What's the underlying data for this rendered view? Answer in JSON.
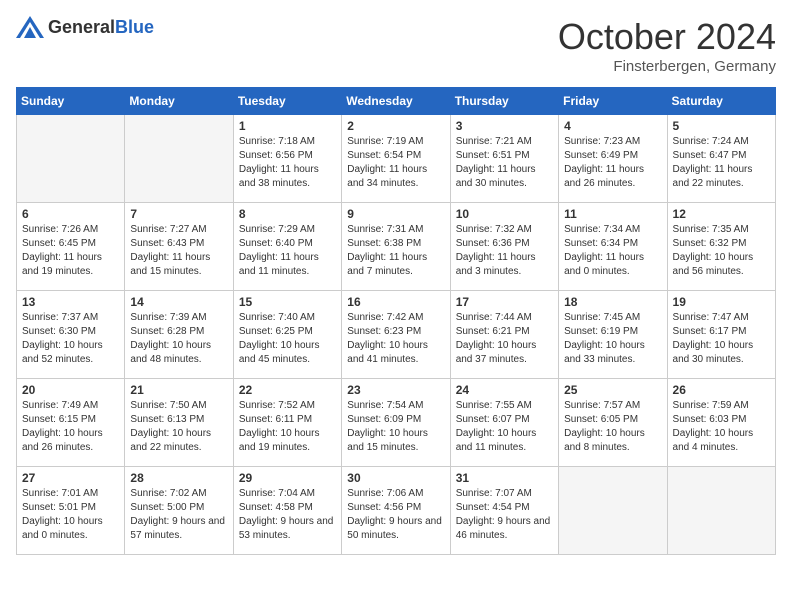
{
  "header": {
    "logo_general": "General",
    "logo_blue": "Blue",
    "month_year": "October 2024",
    "location": "Finsterbergen, Germany"
  },
  "days_of_week": [
    "Sunday",
    "Monday",
    "Tuesday",
    "Wednesday",
    "Thursday",
    "Friday",
    "Saturday"
  ],
  "weeks": [
    [
      {
        "day": "",
        "sunrise": "",
        "sunset": "",
        "daylight": "",
        "empty": true
      },
      {
        "day": "",
        "sunrise": "",
        "sunset": "",
        "daylight": "",
        "empty": true
      },
      {
        "day": "1",
        "sunrise": "Sunrise: 7:18 AM",
        "sunset": "Sunset: 6:56 PM",
        "daylight": "Daylight: 11 hours and 38 minutes."
      },
      {
        "day": "2",
        "sunrise": "Sunrise: 7:19 AM",
        "sunset": "Sunset: 6:54 PM",
        "daylight": "Daylight: 11 hours and 34 minutes."
      },
      {
        "day": "3",
        "sunrise": "Sunrise: 7:21 AM",
        "sunset": "Sunset: 6:51 PM",
        "daylight": "Daylight: 11 hours and 30 minutes."
      },
      {
        "day": "4",
        "sunrise": "Sunrise: 7:23 AM",
        "sunset": "Sunset: 6:49 PM",
        "daylight": "Daylight: 11 hours and 26 minutes."
      },
      {
        "day": "5",
        "sunrise": "Sunrise: 7:24 AM",
        "sunset": "Sunset: 6:47 PM",
        "daylight": "Daylight: 11 hours and 22 minutes."
      }
    ],
    [
      {
        "day": "6",
        "sunrise": "Sunrise: 7:26 AM",
        "sunset": "Sunset: 6:45 PM",
        "daylight": "Daylight: 11 hours and 19 minutes."
      },
      {
        "day": "7",
        "sunrise": "Sunrise: 7:27 AM",
        "sunset": "Sunset: 6:43 PM",
        "daylight": "Daylight: 11 hours and 15 minutes."
      },
      {
        "day": "8",
        "sunrise": "Sunrise: 7:29 AM",
        "sunset": "Sunset: 6:40 PM",
        "daylight": "Daylight: 11 hours and 11 minutes."
      },
      {
        "day": "9",
        "sunrise": "Sunrise: 7:31 AM",
        "sunset": "Sunset: 6:38 PM",
        "daylight": "Daylight: 11 hours and 7 minutes."
      },
      {
        "day": "10",
        "sunrise": "Sunrise: 7:32 AM",
        "sunset": "Sunset: 6:36 PM",
        "daylight": "Daylight: 11 hours and 3 minutes."
      },
      {
        "day": "11",
        "sunrise": "Sunrise: 7:34 AM",
        "sunset": "Sunset: 6:34 PM",
        "daylight": "Daylight: 11 hours and 0 minutes."
      },
      {
        "day": "12",
        "sunrise": "Sunrise: 7:35 AM",
        "sunset": "Sunset: 6:32 PM",
        "daylight": "Daylight: 10 hours and 56 minutes."
      }
    ],
    [
      {
        "day": "13",
        "sunrise": "Sunrise: 7:37 AM",
        "sunset": "Sunset: 6:30 PM",
        "daylight": "Daylight: 10 hours and 52 minutes."
      },
      {
        "day": "14",
        "sunrise": "Sunrise: 7:39 AM",
        "sunset": "Sunset: 6:28 PM",
        "daylight": "Daylight: 10 hours and 48 minutes."
      },
      {
        "day": "15",
        "sunrise": "Sunrise: 7:40 AM",
        "sunset": "Sunset: 6:25 PM",
        "daylight": "Daylight: 10 hours and 45 minutes."
      },
      {
        "day": "16",
        "sunrise": "Sunrise: 7:42 AM",
        "sunset": "Sunset: 6:23 PM",
        "daylight": "Daylight: 10 hours and 41 minutes."
      },
      {
        "day": "17",
        "sunrise": "Sunrise: 7:44 AM",
        "sunset": "Sunset: 6:21 PM",
        "daylight": "Daylight: 10 hours and 37 minutes."
      },
      {
        "day": "18",
        "sunrise": "Sunrise: 7:45 AM",
        "sunset": "Sunset: 6:19 PM",
        "daylight": "Daylight: 10 hours and 33 minutes."
      },
      {
        "day": "19",
        "sunrise": "Sunrise: 7:47 AM",
        "sunset": "Sunset: 6:17 PM",
        "daylight": "Daylight: 10 hours and 30 minutes."
      }
    ],
    [
      {
        "day": "20",
        "sunrise": "Sunrise: 7:49 AM",
        "sunset": "Sunset: 6:15 PM",
        "daylight": "Daylight: 10 hours and 26 minutes."
      },
      {
        "day": "21",
        "sunrise": "Sunrise: 7:50 AM",
        "sunset": "Sunset: 6:13 PM",
        "daylight": "Daylight: 10 hours and 22 minutes."
      },
      {
        "day": "22",
        "sunrise": "Sunrise: 7:52 AM",
        "sunset": "Sunset: 6:11 PM",
        "daylight": "Daylight: 10 hours and 19 minutes."
      },
      {
        "day": "23",
        "sunrise": "Sunrise: 7:54 AM",
        "sunset": "Sunset: 6:09 PM",
        "daylight": "Daylight: 10 hours and 15 minutes."
      },
      {
        "day": "24",
        "sunrise": "Sunrise: 7:55 AM",
        "sunset": "Sunset: 6:07 PM",
        "daylight": "Daylight: 10 hours and 11 minutes."
      },
      {
        "day": "25",
        "sunrise": "Sunrise: 7:57 AM",
        "sunset": "Sunset: 6:05 PM",
        "daylight": "Daylight: 10 hours and 8 minutes."
      },
      {
        "day": "26",
        "sunrise": "Sunrise: 7:59 AM",
        "sunset": "Sunset: 6:03 PM",
        "daylight": "Daylight: 10 hours and 4 minutes."
      }
    ],
    [
      {
        "day": "27",
        "sunrise": "Sunrise: 7:01 AM",
        "sunset": "Sunset: 5:01 PM",
        "daylight": "Daylight: 10 hours and 0 minutes."
      },
      {
        "day": "28",
        "sunrise": "Sunrise: 7:02 AM",
        "sunset": "Sunset: 5:00 PM",
        "daylight": "Daylight: 9 hours and 57 minutes."
      },
      {
        "day": "29",
        "sunrise": "Sunrise: 7:04 AM",
        "sunset": "Sunset: 4:58 PM",
        "daylight": "Daylight: 9 hours and 53 minutes."
      },
      {
        "day": "30",
        "sunrise": "Sunrise: 7:06 AM",
        "sunset": "Sunset: 4:56 PM",
        "daylight": "Daylight: 9 hours and 50 minutes."
      },
      {
        "day": "31",
        "sunrise": "Sunrise: 7:07 AM",
        "sunset": "Sunset: 4:54 PM",
        "daylight": "Daylight: 9 hours and 46 minutes."
      },
      {
        "day": "",
        "sunrise": "",
        "sunset": "",
        "daylight": "",
        "empty": true
      },
      {
        "day": "",
        "sunrise": "",
        "sunset": "",
        "daylight": "",
        "empty": true
      }
    ]
  ]
}
